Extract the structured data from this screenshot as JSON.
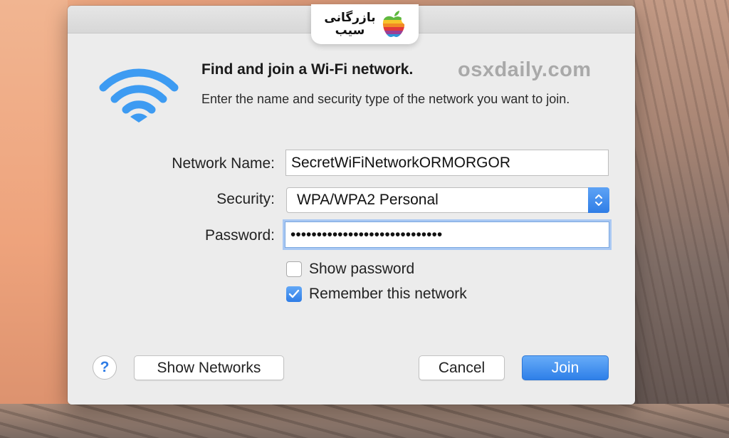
{
  "branding": {
    "badge_line1": "بازرگانی",
    "badge_line2": "سیب",
    "watermark": "osxdaily.com"
  },
  "dialog": {
    "title": "Find and join a Wi-Fi network.",
    "description": "Enter the name and security type of the network you want to join."
  },
  "form": {
    "network_name_label": "Network Name:",
    "network_name_value": "SecretWiFiNetworkORMORGOR",
    "security_label": "Security:",
    "security_value": "WPA/WPA2 Personal",
    "password_label": "Password:",
    "password_value": "•••••••••••••••••••••••••••••",
    "show_password_label": "Show password",
    "show_password_checked": false,
    "remember_network_label": "Remember this network",
    "remember_network_checked": true
  },
  "buttons": {
    "help_label": "?",
    "show_networks_label": "Show Networks",
    "cancel_label": "Cancel",
    "join_label": "Join"
  },
  "colors": {
    "accent": "#2f7de6",
    "wifi_icon": "#3d9bf2",
    "dialog_bg": "#ececec"
  },
  "icons": {
    "wifi": "wifi-icon",
    "apple_logo": "rainbow-apple-icon",
    "stepper": "up-down-chevron-icon",
    "checkmark": "checkmark-icon"
  }
}
